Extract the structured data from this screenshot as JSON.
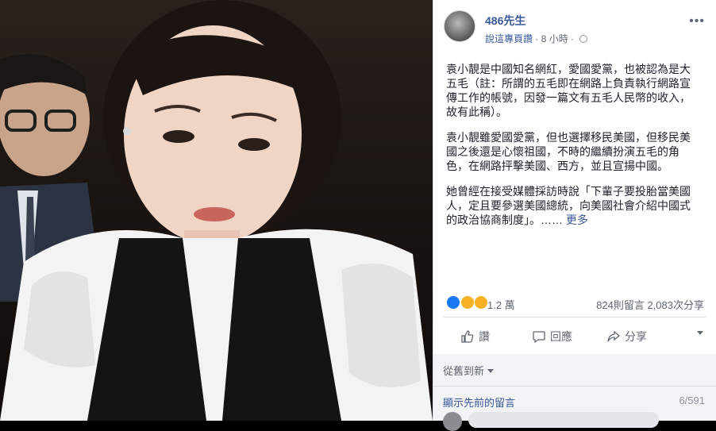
{
  "post": {
    "page_name": "486先生",
    "subtitle_link": "說這專頁讚",
    "separator": "·",
    "time": "8 小時",
    "more_icon": "more-icon",
    "paragraphs": [
      "袁小靚是中國知名網紅，愛國愛黨，也被認為是大五毛（註：所謂的五毛即在網路上負責執行網路宣傳工作的帳號，因發一篇文有五毛人民幣的收入，故有此稱）。",
      "袁小靚雖愛國愛黨，但也選擇移民美國，但移民美國之後還是心懷祖國，不時的繼續扮演五毛的角色，在網路抨擊美國、西方，並且宣揚中國。",
      "她曾經在接受媒體採訪時說「下輩子要投胎當美國人，定且要參選美國總統，向美國社會介紹中國式的政治協商制度」。……"
    ],
    "more_link": "更多"
  },
  "stats": {
    "reaction_count": "1.2 萬",
    "comments": "824則留言",
    "shares": "2,083次分享"
  },
  "actions": {
    "like": "讚",
    "comment": "回應",
    "share": "分享"
  },
  "comments": {
    "sort": "從舊到新",
    "previous": "顯示先前的留言",
    "count": "6/591"
  },
  "colors": {
    "link": "#385898",
    "text": "#1d2129",
    "muted": "#606770"
  }
}
